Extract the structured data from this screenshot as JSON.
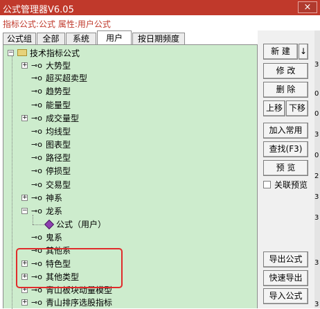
{
  "window": {
    "title": "公式管理器V6.05",
    "close_label": "×"
  },
  "info": {
    "label": "指标公式:公式 属性:用户公式"
  },
  "tabs": [
    {
      "label": "公式组",
      "active": false
    },
    {
      "label": "全部",
      "active": false
    },
    {
      "label": "系统",
      "active": false
    },
    {
      "label": "用户",
      "active": true
    },
    {
      "label": "按日期频度",
      "active": false
    }
  ],
  "tree": {
    "root": "技术指标公式",
    "items": [
      {
        "label": "大势型",
        "expandable": true,
        "expanded": false
      },
      {
        "label": "超买超卖型",
        "expandable": false
      },
      {
        "label": "趋势型",
        "expandable": false
      },
      {
        "label": "能量型",
        "expandable": false
      },
      {
        "label": "成交量型",
        "expandable": true,
        "expanded": false
      },
      {
        "label": "均线型",
        "expandable": false
      },
      {
        "label": "图表型",
        "expandable": false
      },
      {
        "label": "路径型",
        "expandable": false
      },
      {
        "label": "停损型",
        "expandable": false
      },
      {
        "label": "交易型",
        "expandable": false
      },
      {
        "label": "神系",
        "expandable": true,
        "expanded": false
      },
      {
        "label": "龙系",
        "expandable": true,
        "expanded": true,
        "children": [
          {
            "label": "公式（用户）"
          }
        ]
      },
      {
        "label": "鬼系",
        "expandable": false
      },
      {
        "label": "其他系",
        "expandable": false
      },
      {
        "label": "特色型",
        "expandable": true,
        "expanded": false
      },
      {
        "label": "其他类型",
        "expandable": true,
        "expanded": false
      },
      {
        "label": "青山板块动量模型",
        "expandable": true,
        "expanded": false
      },
      {
        "label": "青山排序选股指标",
        "expandable": true,
        "expanded": false
      }
    ]
  },
  "buttons": {
    "new": "新 建",
    "arrow": "↓",
    "modify": "修 改",
    "delete": "删 除",
    "move_up": "上移",
    "move_down": "下移",
    "add_common": "加入常用",
    "find": "查找(F3)",
    "preview": "预 览",
    "link_preview": "关联预览",
    "export_formula": "导出公式",
    "quick_export": "快速导出",
    "import_formula": "导入公式"
  },
  "sidebar_digits": [
    "3",
    "0",
    "0",
    "3",
    "0",
    "2",
    "3",
    "3",
    "3",
    "3"
  ],
  "colors": {
    "titlebar": "#c0392b",
    "tree_bg": "#cdeccd",
    "highlight": "#e02b2b"
  }
}
